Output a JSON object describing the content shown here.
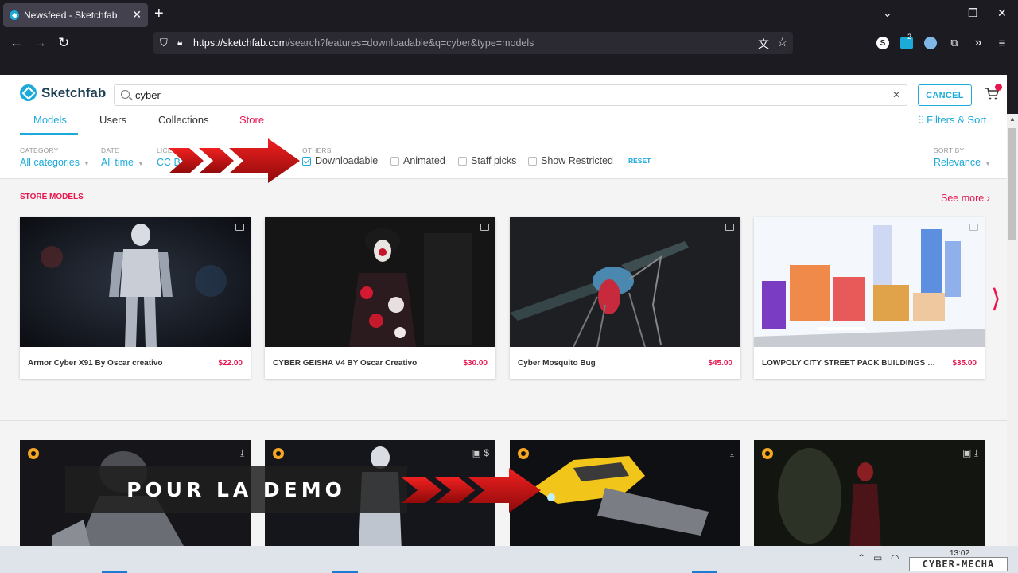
{
  "browser": {
    "tab_title": "Newsfeed - Sketchfab",
    "tab_close": "✕",
    "new_tab": "+",
    "url_host": "https://sketchfab.com",
    "url_rest": "/search?features=downloadable&q=cyber&type=models",
    "ext_badge": "2"
  },
  "header": {
    "logo_text": "Sketchfab",
    "search_value": "cyber",
    "cancel_label": "CANCEL",
    "tabs": [
      {
        "label": "Models"
      },
      {
        "label": "Users"
      },
      {
        "label": "Collections"
      },
      {
        "label": "Store"
      }
    ],
    "filters_sort_label": "Filters & Sort",
    "accent_color": "#1caad9",
    "store_color": "#e8164e"
  },
  "filters": {
    "category": {
      "label": "CATEGORY",
      "value": "All categories"
    },
    "date": {
      "label": "DATE",
      "value": "All time"
    },
    "license": {
      "label": "LICE",
      "value": "CC BY"
    },
    "others_label": "OTHERS",
    "checkboxes": [
      {
        "label": "Downloadable",
        "checked": true
      },
      {
        "label": "Animated",
        "checked": false
      },
      {
        "label": "Staff picks",
        "checked": false
      },
      {
        "label": "Show Restricted",
        "checked": false
      }
    ],
    "reset_label": "RESET",
    "sort": {
      "label": "SORT BY",
      "value": "Relevance"
    }
  },
  "store": {
    "section_title": "STORE MODELS",
    "see_more": "See more ›",
    "cards": [
      {
        "title": "Armor Cyber X91 By Oscar creativo",
        "price": "$22.00"
      },
      {
        "title": "CYBER GEISHA V4 BY Oscar Creativo",
        "price": "$30.00"
      },
      {
        "title": "Cyber Mosquito Bug",
        "price": "$45.00"
      },
      {
        "title": "LOWPOLY CITY STREET PACK BUILDINGS S...",
        "price": "$35.00"
      }
    ]
  },
  "overlay": {
    "demo_text": "POUR LA DEMO"
  },
  "taskbar": {
    "time": "13:02",
    "watermark": "CYBER-MECHA"
  }
}
